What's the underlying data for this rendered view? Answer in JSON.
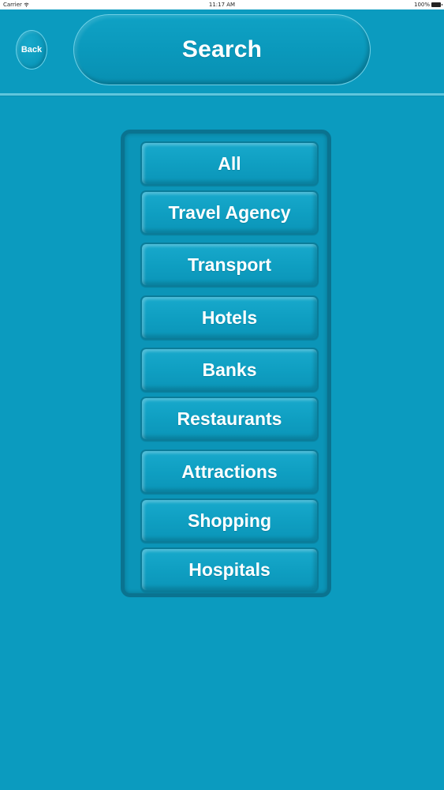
{
  "status_bar": {
    "carrier": "Carrier",
    "time": "11:17 AM",
    "battery": "100%"
  },
  "header": {
    "back_label": "Back",
    "title": "Search"
  },
  "categories": [
    {
      "label": "All"
    },
    {
      "label": "Travel Agency"
    },
    {
      "label": "Transport"
    },
    {
      "label": "Hotels"
    },
    {
      "label": "Banks"
    },
    {
      "label": "Restaurants"
    },
    {
      "label": "Attractions"
    },
    {
      "label": "Shopping"
    },
    {
      "label": "Hospitals"
    }
  ],
  "colors": {
    "background": "#0b9bbf",
    "panel_border": "#0a7390",
    "text": "#ffffff"
  }
}
